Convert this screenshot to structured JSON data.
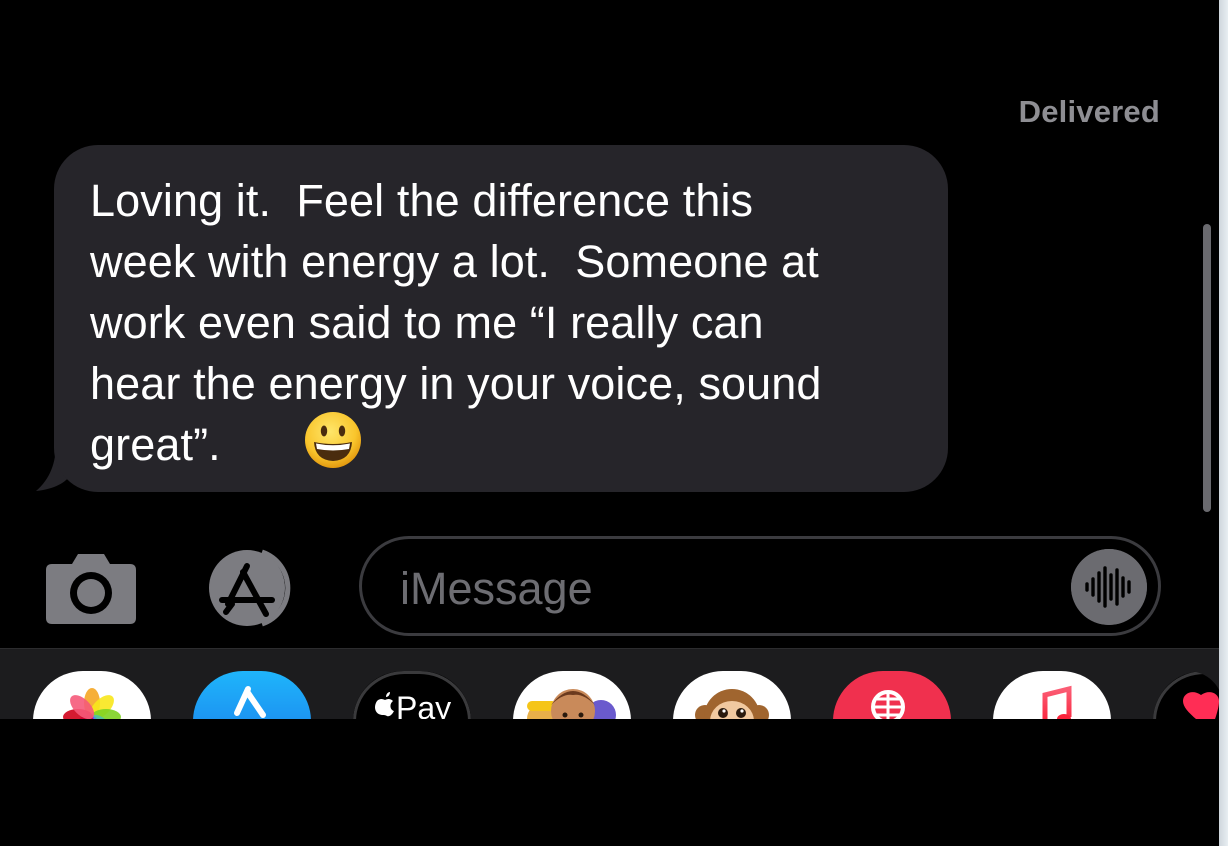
{
  "status": {
    "delivered_label": "Delivered"
  },
  "message": {
    "text": "Loving it.  Feel the difference this\nweek with energy a lot.  Someone at\nwork even said to me “I really can\nhear the energy in your voice, sound\ngreat”.",
    "emoji": "grinning-face-emoji",
    "bubble_color": "#26252a",
    "text_color": "#ffffff"
  },
  "input_bar": {
    "placeholder": "iMessage",
    "camera_icon": "camera-icon",
    "apps_icon": "app-store-icon",
    "audio_icon": "audio-waveform-icon"
  },
  "app_drawer": {
    "apps": [
      {
        "name": "Photos",
        "icon": "photos-icon"
      },
      {
        "name": "App Store",
        "icon": "app-store-icon"
      },
      {
        "name": "Apple Pay",
        "icon": "apple-pay-icon",
        "label": "Pay"
      },
      {
        "name": "Memoji Stickers",
        "icon": "memoji-icon"
      },
      {
        "name": "Animoji",
        "icon": "monkey-animoji-icon"
      },
      {
        "name": "Search Images",
        "icon": "globe-search-icon"
      },
      {
        "name": "Music",
        "icon": "music-icon"
      },
      {
        "name": "Digital Touch",
        "icon": "heart-icon"
      }
    ]
  },
  "colors": {
    "background": "#000000",
    "secondary_text": "#8e8e93",
    "drawer_background": "#1c1c1e"
  }
}
